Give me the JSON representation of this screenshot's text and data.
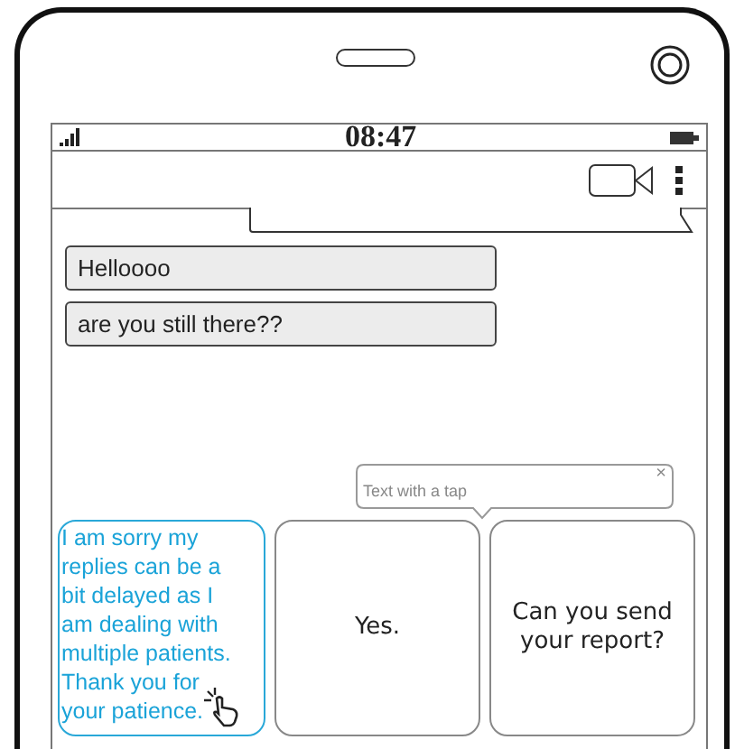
{
  "status_bar": {
    "time": "08:47"
  },
  "messages": [
    {
      "text": "Helloooo"
    },
    {
      "text": "are you still there??"
    }
  ],
  "tooltip": {
    "text": "Text with a tap",
    "close": "×"
  },
  "suggestions": [
    {
      "text": "I am sorry my\nreplies can be a\nbit delayed as I\nam dealing with\nmultiple patients.\nThank you for\nyour patience.",
      "selected": true
    },
    {
      "text": "Yes.",
      "selected": false
    },
    {
      "text": "Can you send\nyour report?",
      "selected": false
    }
  ]
}
